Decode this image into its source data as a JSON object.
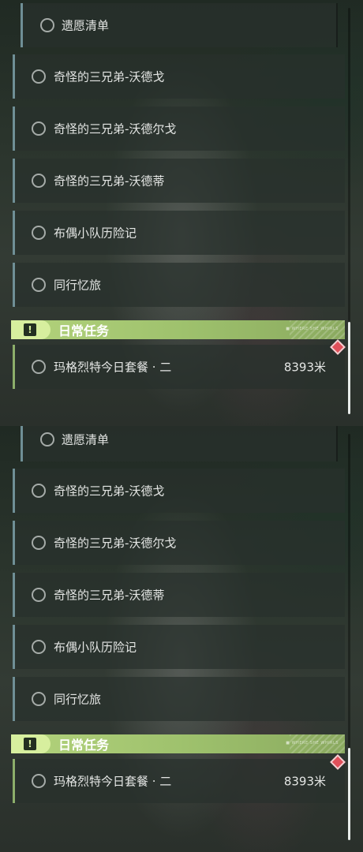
{
  "panels": [
    {
      "quests": [
        {
          "label": "遗愿清单"
        },
        {
          "label": "奇怪的三兄弟-沃德戈"
        },
        {
          "label": "奇怪的三兄弟-沃德尔戈"
        },
        {
          "label": "奇怪的三兄弟-沃德蒂"
        },
        {
          "label": "布偶小队历险记"
        },
        {
          "label": "同行忆旅"
        }
      ],
      "daily": {
        "section_title": "日常任务",
        "badge_icon": "!",
        "tiny_text": "■ WHERE SHE WHIRLS",
        "quest_label": "玛格烈特今日套餐 · 二",
        "distance": "8393米"
      }
    },
    {
      "quests": [
        {
          "label": "遗愿清单"
        },
        {
          "label": "奇怪的三兄弟-沃德戈"
        },
        {
          "label": "奇怪的三兄弟-沃德尔戈"
        },
        {
          "label": "奇怪的三兄弟-沃德蒂"
        },
        {
          "label": "布偶小队历险记"
        },
        {
          "label": "同行忆旅"
        }
      ],
      "daily": {
        "section_title": "日常任务",
        "badge_icon": "!",
        "tiny_text": "■ WHERE SHE WHIRLS",
        "quest_label": "玛格烈特今日套餐 · 二",
        "distance": "8393米"
      }
    }
  ],
  "colors": {
    "accent_green": "#b3d37c",
    "quest_bar": "#6f8f96",
    "marker_red": "#e0505a"
  }
}
